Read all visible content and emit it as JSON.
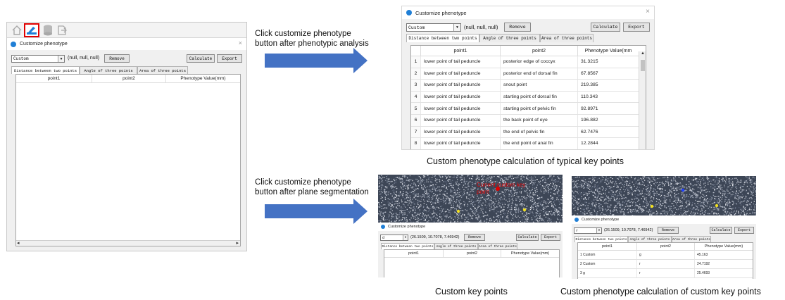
{
  "colors": {
    "arrow_blue": "#4472c4",
    "icon_blue": "#1f7fd6",
    "highlight_red": "#e00000"
  },
  "left_panel": {
    "toolbar_icons": [
      "home-icon",
      "customize-phenotype-icon",
      "database-icon",
      "export-icon"
    ],
    "window": {
      "title": "Customize phenotype",
      "close": "×",
      "combo_value": "Custom",
      "combo_arrow": "▼",
      "coords": "(null, null, null)",
      "remove": "Remove",
      "calculate": "Calculate",
      "export": "Export",
      "tabs": [
        "Distance between two points",
        "Angle of three points",
        "Area of three points"
      ],
      "columns": [
        "point1",
        "point2",
        "Phenotype Value(mm)"
      ],
      "scroll_left": "◂",
      "scroll_right": "▸"
    }
  },
  "annotations": {
    "top_instruction": [
      "Click customize phenotype",
      "button after phenotypic analysis"
    ],
    "bottom_instruction": [
      "Click customize phenotype",
      "button after plane segmentation"
    ],
    "caption_typical": "Custom phenotype calculation of typical key points",
    "caption_custom_points": "Custom key points",
    "caption_custom_calc": "Custom phenotype calculation of custom key points"
  },
  "typical_window": {
    "title": "Customize phenotype",
    "close": "×",
    "combo_value": "Custom",
    "combo_arrow": "▼",
    "coords": "(null, null, null)",
    "remove": "Remove",
    "calculate": "Calculate",
    "export": "Export",
    "tabs": [
      "Distance between two points",
      "Angle of three points",
      "Area of three points"
    ],
    "columns": [
      "point1",
      "point2",
      "Phenotype Value(mm"
    ],
    "scroll_up": "▲",
    "rows": [
      {
        "idx": "1",
        "p1": "lower point of tail peduncle",
        "p2": "posterior edge of coccyx",
        "val": "31.3215"
      },
      {
        "idx": "2",
        "p1": "lower point of tail peduncle",
        "p2": "posterior end of dorsal fin",
        "val": "67.8567"
      },
      {
        "idx": "3",
        "p1": "lower point of tail peduncle",
        "p2": "snout point",
        "val": "219.385"
      },
      {
        "idx": "4",
        "p1": "lower point of tail peduncle",
        "p2": "starting point of dorsal fin",
        "val": "110.343"
      },
      {
        "idx": "5",
        "p1": "lower point of tail peduncle",
        "p2": "starting point of pelvic fin",
        "val": "92.8971"
      },
      {
        "idx": "6",
        "p1": "lower point of tail peduncle",
        "p2": "the back point of eye",
        "val": "196.882"
      },
      {
        "idx": "7",
        "p1": "lower point of tail peduncle",
        "p2": "the end of pelvic fin",
        "val": "62.7476"
      },
      {
        "idx": "8",
        "p1": "lower point of tail peduncle",
        "p2": "the end point of anal fin",
        "val": "12.2844"
      }
    ]
  },
  "custom_points_window": {
    "scene_label": "Current custom key point",
    "title": "Customize phenotype",
    "combo_value": "d",
    "combo_arrow": "▼",
    "coords": "(26.1509, 10.7078, 7.46942)",
    "remove": "Remove",
    "calculate": "Calculate",
    "export": "Export",
    "tabs": [
      "Distance between two points",
      "Angle of three points",
      "Area of three points"
    ],
    "columns": [
      "point1",
      "point2",
      "Phenotype Value(mm)"
    ]
  },
  "custom_calc_window": {
    "title": "Customize phenotype",
    "combo_value": "r",
    "combo_arrow": "▼",
    "coords": "(26.1509, 10.7078, 7.46942)",
    "remove": "Remove",
    "calculate": "Calculate",
    "export": "Export",
    "tabs": [
      "Distance between two points",
      "Angle of three points",
      "Area of three points"
    ],
    "columns": [
      "point1",
      "point2",
      "Phenotype Value(mm)"
    ],
    "rows": [
      {
        "label": "1 Custom",
        "p2": "g",
        "val": "45.163"
      },
      {
        "label": "2 Custom",
        "p2": "r",
        "val": "24.7192"
      },
      {
        "label": "3 g",
        "p2": "r",
        "val": "25.4693"
      }
    ]
  }
}
